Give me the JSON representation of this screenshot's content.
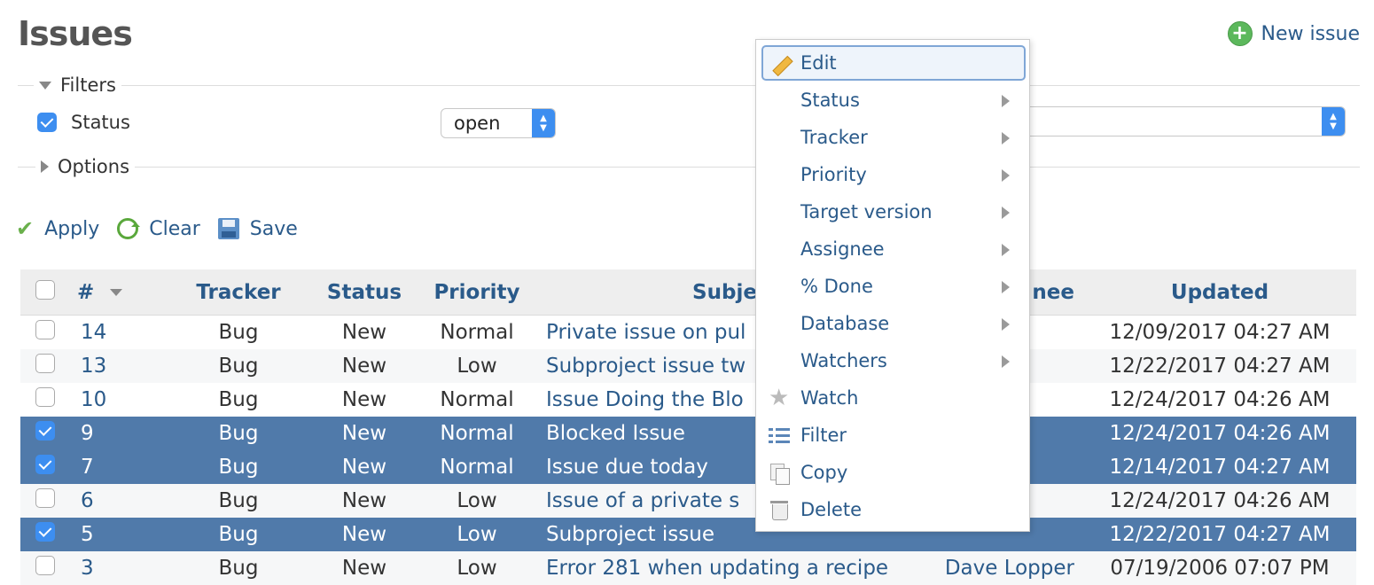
{
  "header": {
    "title": "Issues",
    "new_issue_label": "New issue"
  },
  "filters": {
    "legend": "Filters",
    "status_label": "Status",
    "status_operator": "open",
    "options_legend": "Options"
  },
  "actions": {
    "apply": "Apply",
    "clear": "Clear",
    "save": "Save"
  },
  "table": {
    "columns": [
      "#",
      "Tracker",
      "Status",
      "Priority",
      "Subje",
      "nee",
      "Updated"
    ],
    "rows": [
      {
        "id": "14",
        "tracker": "Bug",
        "status": "New",
        "priority": "Normal",
        "subject": "Private issue on pul",
        "assignee": "",
        "updated": "12/09/2017 04:27 AM",
        "selected": false
      },
      {
        "id": "13",
        "tracker": "Bug",
        "status": "New",
        "priority": "Low",
        "subject": "Subproject issue tw",
        "assignee": "",
        "updated": "12/22/2017 04:27 AM",
        "selected": false
      },
      {
        "id": "10",
        "tracker": "Bug",
        "status": "New",
        "priority": "Normal",
        "subject": "Issue Doing the Blo",
        "assignee": "",
        "updated": "12/24/2017 04:26 AM",
        "selected": false
      },
      {
        "id": "9",
        "tracker": "Bug",
        "status": "New",
        "priority": "Normal",
        "subject": "Blocked Issue",
        "assignee": "",
        "updated": "12/24/2017 04:26 AM",
        "selected": true
      },
      {
        "id": "7",
        "tracker": "Bug",
        "status": "New",
        "priority": "Normal",
        "subject": "Issue due today",
        "assignee": "",
        "updated": "12/14/2017 04:27 AM",
        "selected": true
      },
      {
        "id": "6",
        "tracker": "Bug",
        "status": "New",
        "priority": "Low",
        "subject": "Issue of a private s",
        "assignee": "",
        "updated": "12/24/2017 04:26 AM",
        "selected": false
      },
      {
        "id": "5",
        "tracker": "Bug",
        "status": "New",
        "priority": "Low",
        "subject": "Subproject issue",
        "assignee": "",
        "updated": "12/22/2017 04:27 AM",
        "selected": true
      },
      {
        "id": "3",
        "tracker": "Bug",
        "status": "New",
        "priority": "Low",
        "subject": "Error 281 when updating a recipe",
        "assignee": "Dave Lopper",
        "updated": "07/19/2006 07:07 PM",
        "selected": false
      }
    ]
  },
  "context_menu": {
    "items": [
      {
        "label": "Edit",
        "icon": "pencil-icon",
        "submenu": false
      },
      {
        "label": "Status",
        "icon": "",
        "submenu": true
      },
      {
        "label": "Tracker",
        "icon": "",
        "submenu": true
      },
      {
        "label": "Priority",
        "icon": "",
        "submenu": true
      },
      {
        "label": "Target version",
        "icon": "",
        "submenu": true
      },
      {
        "label": "Assignee",
        "icon": "",
        "submenu": true
      },
      {
        "label": "% Done",
        "icon": "",
        "submenu": true
      },
      {
        "label": "Database",
        "icon": "",
        "submenu": true
      },
      {
        "label": "Watchers",
        "icon": "",
        "submenu": true
      },
      {
        "label": "Watch",
        "icon": "star-icon",
        "submenu": false
      },
      {
        "label": "Filter",
        "icon": "filter-list-icon",
        "submenu": false
      },
      {
        "label": "Copy",
        "icon": "copy-icon",
        "submenu": false
      },
      {
        "label": "Delete",
        "icon": "trash-icon",
        "submenu": false
      }
    ]
  },
  "colors": {
    "link": "#2a5a8a",
    "selected_row": "#507aaa",
    "checkbox": "#3d8ef0"
  }
}
